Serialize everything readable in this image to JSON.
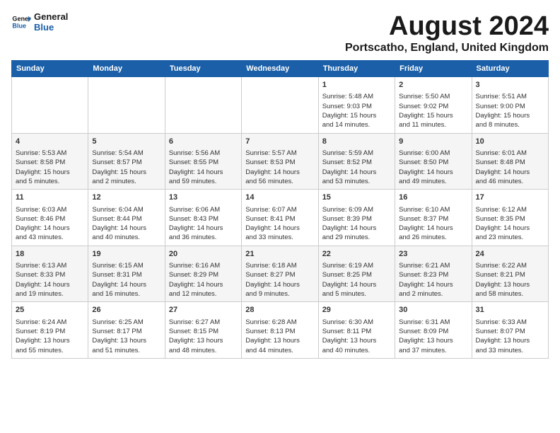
{
  "logo": {
    "general": "General",
    "blue": "Blue"
  },
  "title": "August 2024",
  "subtitle": "Portscatho, England, United Kingdom",
  "headers": [
    "Sunday",
    "Monday",
    "Tuesday",
    "Wednesday",
    "Thursday",
    "Friday",
    "Saturday"
  ],
  "weeks": [
    [
      {
        "day": "",
        "info": ""
      },
      {
        "day": "",
        "info": ""
      },
      {
        "day": "",
        "info": ""
      },
      {
        "day": "",
        "info": ""
      },
      {
        "day": "1",
        "info": "Sunrise: 5:48 AM\nSunset: 9:03 PM\nDaylight: 15 hours\nand 14 minutes."
      },
      {
        "day": "2",
        "info": "Sunrise: 5:50 AM\nSunset: 9:02 PM\nDaylight: 15 hours\nand 11 minutes."
      },
      {
        "day": "3",
        "info": "Sunrise: 5:51 AM\nSunset: 9:00 PM\nDaylight: 15 hours\nand 8 minutes."
      }
    ],
    [
      {
        "day": "4",
        "info": "Sunrise: 5:53 AM\nSunset: 8:58 PM\nDaylight: 15 hours\nand 5 minutes."
      },
      {
        "day": "5",
        "info": "Sunrise: 5:54 AM\nSunset: 8:57 PM\nDaylight: 15 hours\nand 2 minutes."
      },
      {
        "day": "6",
        "info": "Sunrise: 5:56 AM\nSunset: 8:55 PM\nDaylight: 14 hours\nand 59 minutes."
      },
      {
        "day": "7",
        "info": "Sunrise: 5:57 AM\nSunset: 8:53 PM\nDaylight: 14 hours\nand 56 minutes."
      },
      {
        "day": "8",
        "info": "Sunrise: 5:59 AM\nSunset: 8:52 PM\nDaylight: 14 hours\nand 53 minutes."
      },
      {
        "day": "9",
        "info": "Sunrise: 6:00 AM\nSunset: 8:50 PM\nDaylight: 14 hours\nand 49 minutes."
      },
      {
        "day": "10",
        "info": "Sunrise: 6:01 AM\nSunset: 8:48 PM\nDaylight: 14 hours\nand 46 minutes."
      }
    ],
    [
      {
        "day": "11",
        "info": "Sunrise: 6:03 AM\nSunset: 8:46 PM\nDaylight: 14 hours\nand 43 minutes."
      },
      {
        "day": "12",
        "info": "Sunrise: 6:04 AM\nSunset: 8:44 PM\nDaylight: 14 hours\nand 40 minutes."
      },
      {
        "day": "13",
        "info": "Sunrise: 6:06 AM\nSunset: 8:43 PM\nDaylight: 14 hours\nand 36 minutes."
      },
      {
        "day": "14",
        "info": "Sunrise: 6:07 AM\nSunset: 8:41 PM\nDaylight: 14 hours\nand 33 minutes."
      },
      {
        "day": "15",
        "info": "Sunrise: 6:09 AM\nSunset: 8:39 PM\nDaylight: 14 hours\nand 29 minutes."
      },
      {
        "day": "16",
        "info": "Sunrise: 6:10 AM\nSunset: 8:37 PM\nDaylight: 14 hours\nand 26 minutes."
      },
      {
        "day": "17",
        "info": "Sunrise: 6:12 AM\nSunset: 8:35 PM\nDaylight: 14 hours\nand 23 minutes."
      }
    ],
    [
      {
        "day": "18",
        "info": "Sunrise: 6:13 AM\nSunset: 8:33 PM\nDaylight: 14 hours\nand 19 minutes."
      },
      {
        "day": "19",
        "info": "Sunrise: 6:15 AM\nSunset: 8:31 PM\nDaylight: 14 hours\nand 16 minutes."
      },
      {
        "day": "20",
        "info": "Sunrise: 6:16 AM\nSunset: 8:29 PM\nDaylight: 14 hours\nand 12 minutes."
      },
      {
        "day": "21",
        "info": "Sunrise: 6:18 AM\nSunset: 8:27 PM\nDaylight: 14 hours\nand 9 minutes."
      },
      {
        "day": "22",
        "info": "Sunrise: 6:19 AM\nSunset: 8:25 PM\nDaylight: 14 hours\nand 5 minutes."
      },
      {
        "day": "23",
        "info": "Sunrise: 6:21 AM\nSunset: 8:23 PM\nDaylight: 14 hours\nand 2 minutes."
      },
      {
        "day": "24",
        "info": "Sunrise: 6:22 AM\nSunset: 8:21 PM\nDaylight: 13 hours\nand 58 minutes."
      }
    ],
    [
      {
        "day": "25",
        "info": "Sunrise: 6:24 AM\nSunset: 8:19 PM\nDaylight: 13 hours\nand 55 minutes."
      },
      {
        "day": "26",
        "info": "Sunrise: 6:25 AM\nSunset: 8:17 PM\nDaylight: 13 hours\nand 51 minutes."
      },
      {
        "day": "27",
        "info": "Sunrise: 6:27 AM\nSunset: 8:15 PM\nDaylight: 13 hours\nand 48 minutes."
      },
      {
        "day": "28",
        "info": "Sunrise: 6:28 AM\nSunset: 8:13 PM\nDaylight: 13 hours\nand 44 minutes."
      },
      {
        "day": "29",
        "info": "Sunrise: 6:30 AM\nSunset: 8:11 PM\nDaylight: 13 hours\nand 40 minutes."
      },
      {
        "day": "30",
        "info": "Sunrise: 6:31 AM\nSunset: 8:09 PM\nDaylight: 13 hours\nand 37 minutes."
      },
      {
        "day": "31",
        "info": "Sunrise: 6:33 AM\nSunset: 8:07 PM\nDaylight: 13 hours\nand 33 minutes."
      }
    ]
  ]
}
